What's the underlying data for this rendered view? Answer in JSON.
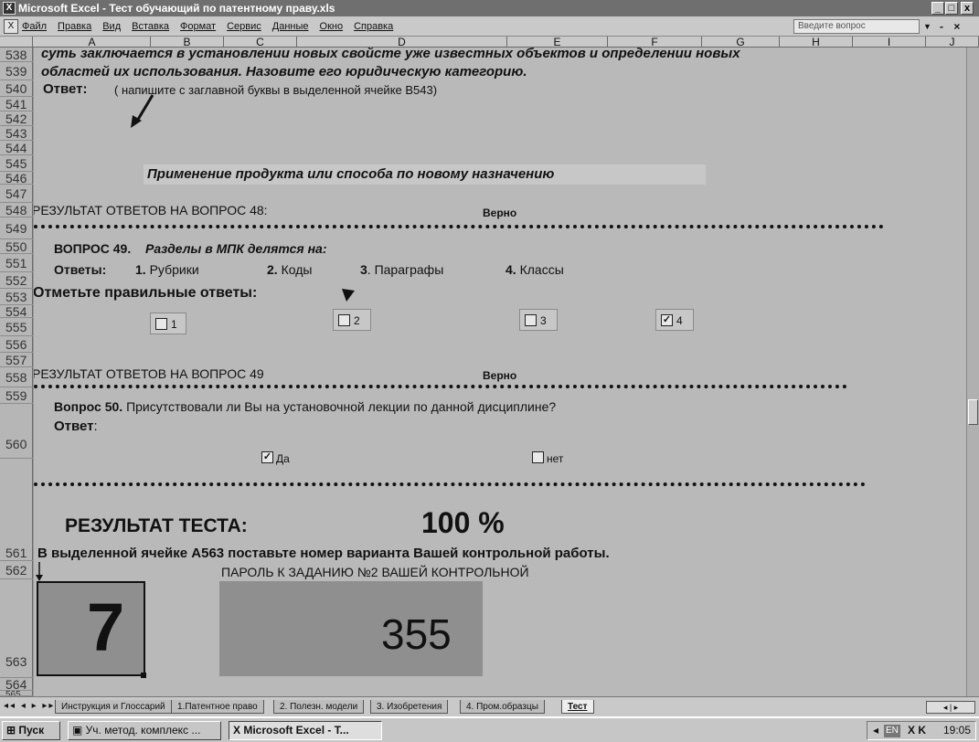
{
  "window": {
    "title": "Microsoft Excel - Тест обучающий по патентному праву.xls",
    "controls": [
      "_",
      "□",
      "x"
    ]
  },
  "menu": {
    "items": [
      "Файл",
      "Правка",
      "Вид",
      "Вставка",
      "Формат",
      "Сервис",
      "Данные",
      "Окно",
      "Справка"
    ],
    "ask_placeholder": "Введите вопрос",
    "mdi_controls": "- ×"
  },
  "columns": [
    "A",
    "B",
    "C",
    "D",
    "E",
    "F",
    "G",
    "H",
    "I",
    "J"
  ],
  "rows": [
    "538",
    "539",
    "540",
    "541",
    "542",
    "543",
    "544",
    "545",
    "546",
    "547",
    "548",
    "549",
    "550",
    "551",
    "552",
    "553",
    "554",
    "555",
    "556",
    "557",
    "558",
    "559",
    "560",
    "561",
    "562",
    "563",
    "564",
    "565"
  ],
  "q48": {
    "line1": "суть заключается в установлении новых свойсте уже известных объектов и определении новых",
    "line2": "областей их использования. Назовите его юридическую категорию.",
    "answer_label": "Ответ:",
    "answer_hint": "( напишите  с заглавной буквы в выделенной ячейке В543)",
    "answer_value": "Применение продукта или способа по новому назначению",
    "result_label": "РЕЗУЛЬТАТ ОТВЕТОВ    НА ВОПРОС 48:",
    "result_value": "Верно"
  },
  "q49": {
    "title": "ВОПРОС 49.",
    "question": "Разделы в МПК делятся на:",
    "answers_label": "Ответы:",
    "options": [
      {
        "num": "1.",
        "text": "Рубрики"
      },
      {
        "num": "2.",
        "text": "Коды"
      },
      {
        "num": "3",
        "text": ". Параграфы"
      },
      {
        "num": "4.",
        "text": "Классы"
      }
    ],
    "mark_label": "Отметьте правильные ответы:",
    "checkboxes": [
      {
        "label": "1",
        "checked": false
      },
      {
        "label": "2",
        "checked": false
      },
      {
        "label": "3",
        "checked": false
      },
      {
        "label": "4",
        "checked": true
      }
    ],
    "result_label": "РЕЗУЛЬТАТ ОТВЕТОВ    НА ВОПРОС 49",
    "result_value": "Верно"
  },
  "q50": {
    "title": "Вопрос 50.",
    "question": "Присутствовали ли Вы на установочной лекции по данной дисциплине?",
    "answer_label": "Ответ",
    "answer_colon": ":",
    "yes": {
      "label": "Да",
      "checked": true
    },
    "no": {
      "label": "нет",
      "checked": false
    }
  },
  "result": {
    "label": "РЕЗУЛЬТАТ ТЕСТА:",
    "value": "100 %",
    "instruction": "В  выделенной ячейке А563 поставьте номер варианта Вашей контрольной работы.",
    "variant": "7",
    "password_label": "ПАРОЛЬ К ЗАДАНИЮ №2 ВАШЕЙ КОНТРОЛЬНОЙ",
    "password": "355"
  },
  "sheet_tabs": [
    "Инструкция и Глоссарий",
    "1.Патентное право",
    "2. Полезн. модели",
    "3. Изобретения",
    "4. Пром.образцы",
    "Тест"
  ],
  "active_tab": "Тест",
  "taskbar": {
    "start": "Пуск",
    "buttons": [
      "Уч. метод. комплекс ...",
      "Microsoft Excel - Т..."
    ],
    "lang": "EN",
    "clock": "19:05"
  }
}
